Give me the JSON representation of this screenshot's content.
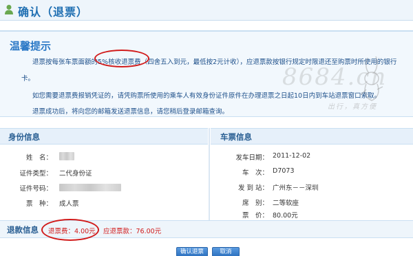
{
  "header": {
    "title": "确认（退票）",
    "icon": "user-icon"
  },
  "notice": {
    "heading": "温馨提示",
    "line1": "退票按每张车票面额的5%核收退票费（四舍五入到元，最低按2元计收），应退票款按银行规定时限退还至购票时所使用的银行",
    "line1b": "卡。",
    "line2": "如您需要退票费报销凭证的，请凭购票所使用的乘车人有效身份证件原件在办理退票之日起10日内到车站退票窗口索取。",
    "line3": "退票成功后，将向您的邮箱发送退票信息，请您稍后登录邮箱查询。"
  },
  "watermark": {
    "text": "8684.cn",
    "slogan": "出行，真方便"
  },
  "identity": {
    "heading": "身份信息",
    "name_label": "姓　名：",
    "id_type_label": "证件类型：",
    "id_type_value": "二代身份证",
    "id_number_label": "证件号码：",
    "ticket_type_label": "票　种：",
    "ticket_type_value": "成人票"
  },
  "ticket": {
    "heading": "车票信息",
    "date_label": "发车日期：",
    "date_value": "2011-12-02",
    "train_label": "车　次：",
    "train_value": "D7073",
    "route_label": "发 到 站：",
    "route_value": "广州东－－深圳",
    "seat_label": "席　别：",
    "seat_value": "二等软座",
    "price_label": "票　价：",
    "price_value": "80.00元"
  },
  "refund": {
    "heading": "退款信息",
    "fee": "退票费：4.00元",
    "amount": "应退票款：76.00元"
  },
  "buttons": {
    "confirm": "确认退票",
    "cancel": "取消"
  },
  "colors": {
    "accent": "#2a78c6",
    "highlight": "#d11b1b",
    "panel": "#e6f0fa"
  }
}
